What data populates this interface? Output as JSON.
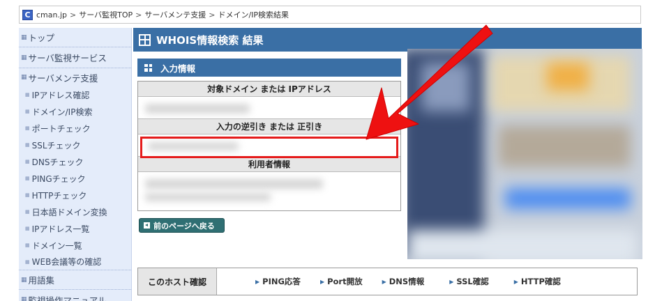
{
  "breadcrumb": {
    "logo": "C",
    "items": [
      "cman.jp",
      "サーバ監視TOP",
      "サーバメンテ支援",
      "ドメイン/IP検索結果"
    ],
    "separator": ">"
  },
  "sidebar": {
    "top": "トップ",
    "monitor": "サーバ監視サービス",
    "maint": "サーバメンテ支援",
    "items": [
      "IPアドレス確認",
      "ドメイン/IP検索",
      "ポートチェック",
      "SSLチェック",
      "DNSチェック",
      "PINGチェック",
      "HTTPチェック",
      "日本語ドメイン変換",
      "IPアドレス一覧",
      "ドメイン一覧",
      "WEB会議等の確認"
    ],
    "glossary": "用語集",
    "manual": "監視操作マニュアル"
  },
  "main": {
    "title": "WHOIS情報検索 結果",
    "section_title": "入力情報",
    "rows": {
      "target_header": "対象ドメイン または IPアドレス",
      "reverse_header": "入力の逆引き または 正引き",
      "user_header": "利用者情報"
    },
    "back_button": "前のページへ戻る"
  },
  "host_confirm": {
    "label": "このホスト確認",
    "links": [
      "PING応答",
      "Port開放",
      "DNS情報",
      "SSL確認",
      "HTTP確認"
    ]
  },
  "colors": {
    "header_blue": "#3a6fa5",
    "sidebar_bg": "#e4ecfa",
    "highlight_red": "#e51b1b",
    "button_teal": "#2f6f73"
  }
}
